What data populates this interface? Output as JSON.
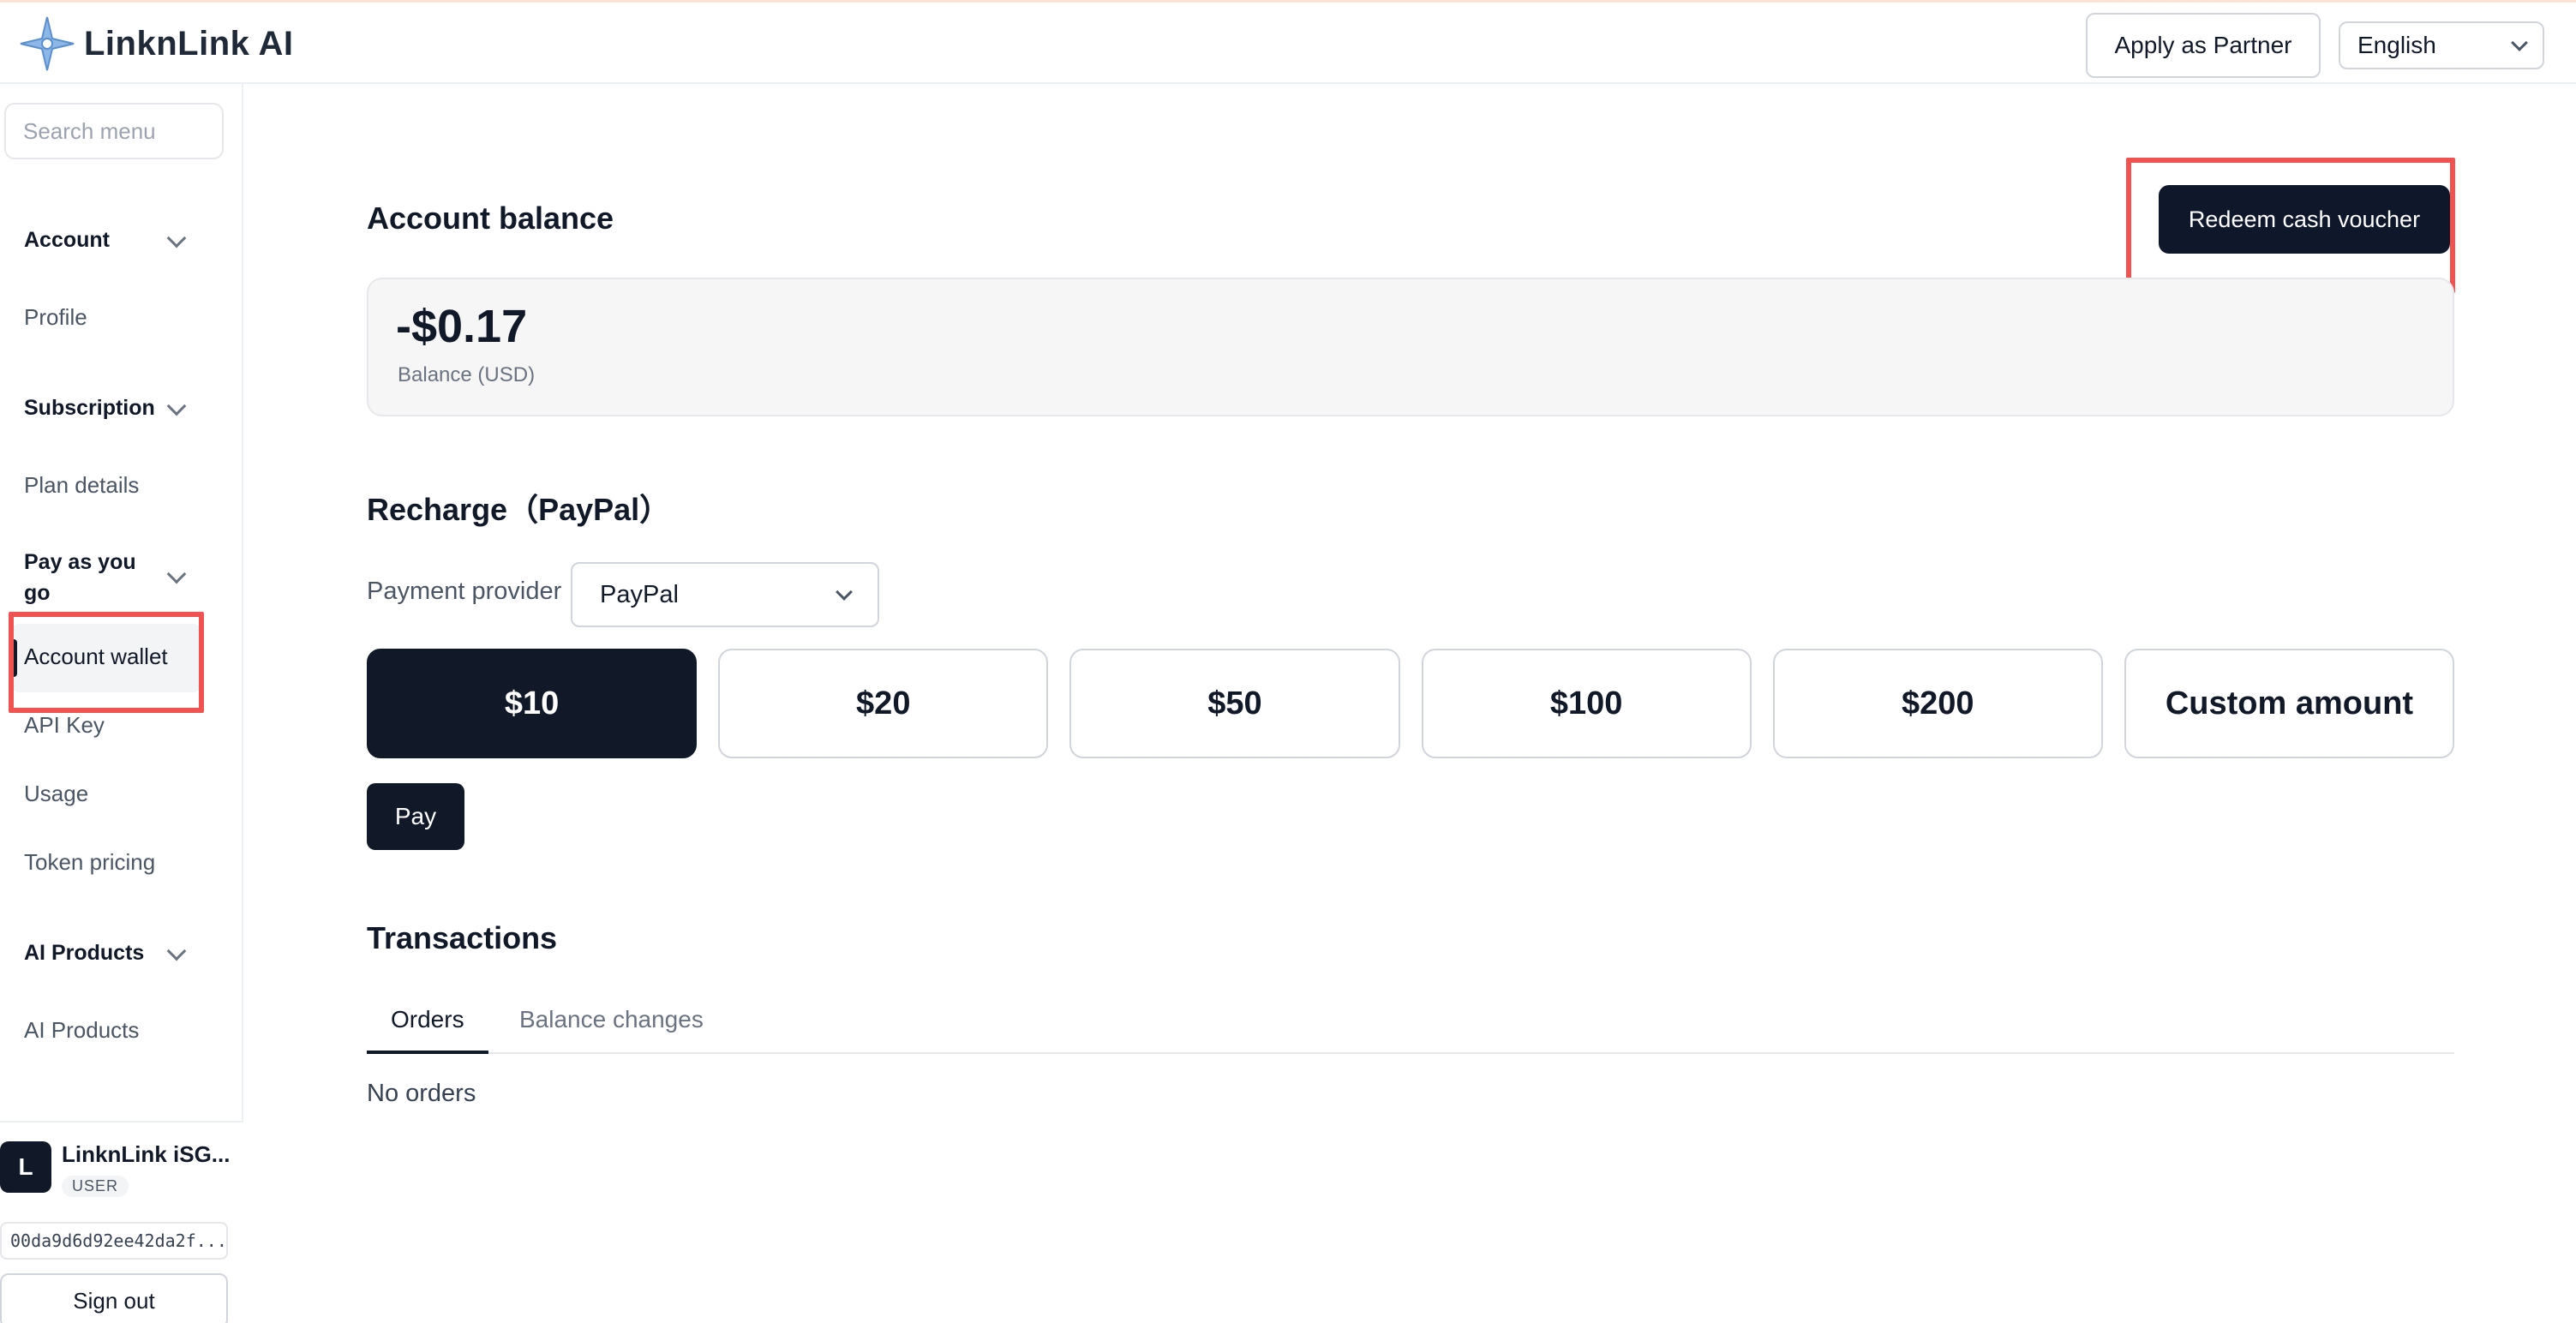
{
  "header": {
    "brand_name": "LinknLink AI",
    "partner_button": "Apply as Partner",
    "language": "English"
  },
  "sidebar": {
    "search_placeholder": "Search menu",
    "groups": [
      {
        "label": "Account",
        "items": [
          "Profile"
        ]
      },
      {
        "label": "Subscription",
        "items": [
          "Plan details"
        ]
      },
      {
        "label": "Pay as you go",
        "items": [
          "Account wallet",
          "API Key",
          "Usage",
          "Token pricing"
        ]
      },
      {
        "label": "AI Products",
        "items": [
          "AI Products"
        ]
      }
    ],
    "active_item": "Account wallet",
    "user": {
      "initial": "L",
      "name": "LinknLink iSG...",
      "role": "USER",
      "id": "00da9d6d92ee42da2f...",
      "sign_out": "Sign out"
    }
  },
  "main": {
    "balance": {
      "title": "Account balance",
      "redeem_button": "Redeem cash voucher",
      "value": "-$0.17",
      "label": "Balance (USD)"
    },
    "recharge": {
      "title": "Recharge（PayPal）",
      "provider_label": "Payment provider",
      "provider_value": "PayPal",
      "amounts": [
        "$10",
        "$20",
        "$50",
        "$100",
        "$200",
        "Custom amount"
      ],
      "selected_amount": "$10",
      "pay_button": "Pay"
    },
    "transactions": {
      "title": "Transactions",
      "tabs": [
        "Orders",
        "Balance changes"
      ],
      "active_tab": "Orders",
      "empty_message": "No orders"
    }
  },
  "colors": {
    "primary_dark": "#111827",
    "highlight": "#ef5350",
    "brand_blue": "#6fa8dc"
  }
}
